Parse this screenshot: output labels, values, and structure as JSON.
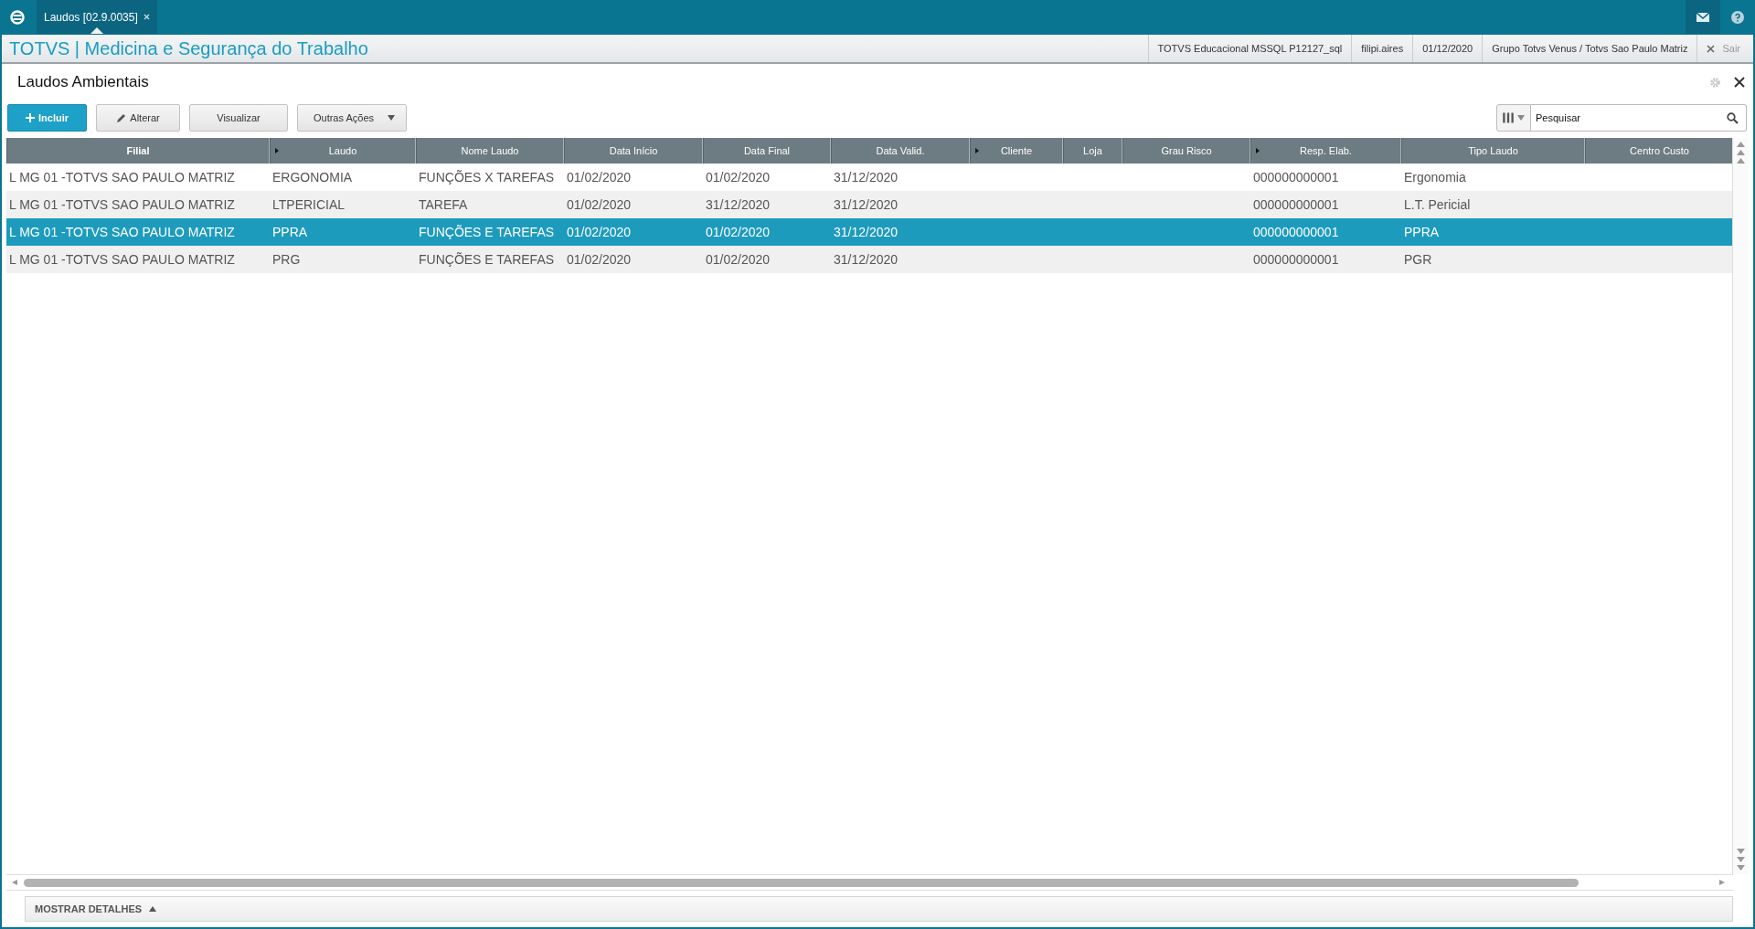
{
  "top_bar": {
    "tabs": [
      {
        "label": "Laudos [02.9.0035]",
        "selected": true
      }
    ]
  },
  "header": {
    "title": "TOTVS | Medicina e Segurança do Trabalho",
    "info": [
      "TOTVS Educacional MSSQL P12127_sql",
      "filipi.aires",
      "01/12/2020",
      "Grupo Totvs Venus / Totvs Sao Paulo Matriz"
    ],
    "exit_label": "Sair"
  },
  "page": {
    "title": "Laudos Ambientais"
  },
  "actions": [
    {
      "kind": "primary",
      "label": "Incluir"
    },
    {
      "kind": "edit",
      "label": "Alterar"
    },
    {
      "kind": "plain",
      "label": "Visualizar"
    },
    {
      "kind": "menu",
      "label": "Outras Ações"
    }
  ],
  "search": {
    "placeholder": "Pesquisar"
  },
  "table": {
    "columns": [
      {
        "label": "Filial",
        "expand_marker": false,
        "bold": true
      },
      {
        "label": "Laudo",
        "expand_marker": true,
        "bold": false
      },
      {
        "label": "Nome Laudo",
        "expand_marker": false,
        "bold": false
      },
      {
        "label": "Data Início",
        "expand_marker": false,
        "bold": false
      },
      {
        "label": "Data Final",
        "expand_marker": false,
        "bold": false
      },
      {
        "label": "Data Valid.",
        "expand_marker": false,
        "bold": false
      },
      {
        "label": "Cliente",
        "expand_marker": true,
        "bold": false
      },
      {
        "label": "Loja",
        "expand_marker": false,
        "bold": false
      },
      {
        "label": "Grau Risco",
        "expand_marker": false,
        "bold": false
      },
      {
        "label": "Resp. Elab.",
        "expand_marker": true,
        "bold": false
      },
      {
        "label": "Tipo Laudo",
        "expand_marker": false,
        "bold": false
      },
      {
        "label": "Centro Custo",
        "expand_marker": false,
        "bold": false
      }
    ],
    "rows": [
      {
        "selected": false,
        "cells": [
          "L MG 01 -TOTVS SAO PAULO MATRIZ",
          "ERGONOMIA",
          "FUNÇÕES X TAREFAS",
          "01/02/2020",
          "01/02/2020",
          "31/12/2020",
          "",
          "",
          "",
          "000000000001",
          "Ergonomia",
          ""
        ]
      },
      {
        "selected": false,
        "cells": [
          "L MG 01 -TOTVS SAO PAULO MATRIZ",
          "LTPERICIAL",
          "TAREFA",
          "01/02/2020",
          "31/12/2020",
          "31/12/2020",
          "",
          "",
          "",
          "000000000001",
          "L.T. Pericial",
          ""
        ]
      },
      {
        "selected": true,
        "cells": [
          "L MG 01 -TOTVS SAO PAULO MATRIZ",
          "PPRA",
          "FUNÇÕES E TAREFAS",
          "01/02/2020",
          "01/02/2020",
          "31/12/2020",
          "",
          "",
          "",
          "000000000001",
          "PPRA",
          ""
        ]
      },
      {
        "selected": false,
        "cells": [
          "L MG 01 -TOTVS SAO PAULO MATRIZ",
          "PRG",
          "FUNÇÕES E TAREFAS",
          "01/02/2020",
          "01/02/2020",
          "31/12/2020",
          "",
          "",
          "",
          "000000000001",
          "PGR",
          ""
        ]
      }
    ]
  },
  "details_bar": {
    "label": "MOSTRAR DETALHES"
  }
}
